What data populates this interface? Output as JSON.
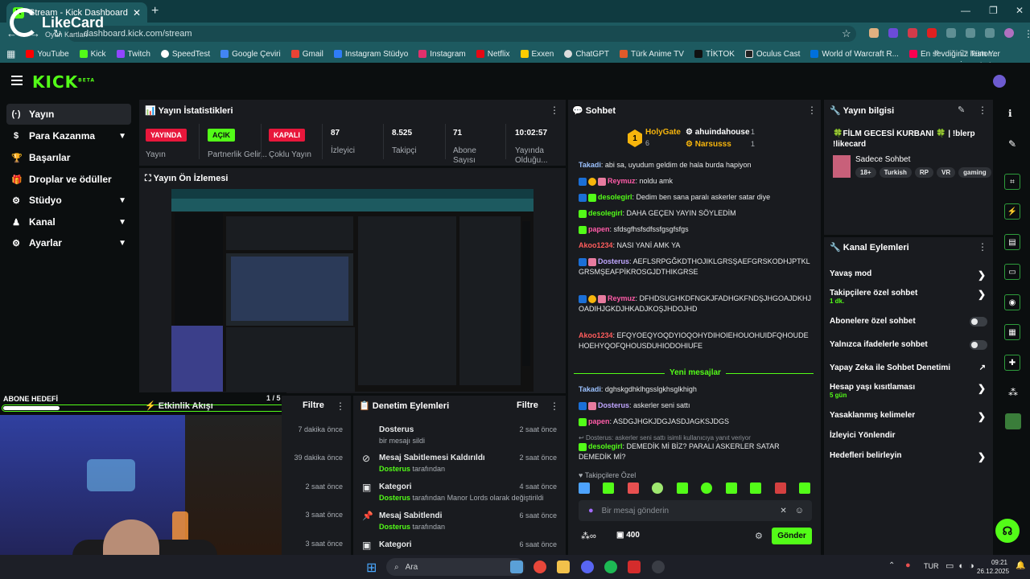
{
  "browser": {
    "tab_title": "Stream - Kick Dashboard",
    "url": "dashboard.kick.com/stream",
    "bookmarks": [
      "YouTube",
      "Kick",
      "Twitch",
      "SpeedTest",
      "Google Çeviri",
      "Gmail",
      "Instagram Stüdyo",
      "Instagram",
      "Netflix",
      "Exxen",
      "ChatGPT",
      "Türk Anime TV",
      "TİKTOK",
      "Oculus Cast",
      "World of Warcraft R...",
      "En sevdiğiniz restor..."
    ],
    "all_bookmarks": "Tüm Yer İşaretleri",
    "watermark_brand": "LikeCard",
    "watermark_sub": "Oyun Kartları"
  },
  "app": {
    "logo": "KICK",
    "logo_sup": "BETA"
  },
  "sidebar": {
    "items": [
      {
        "label": "Yayın",
        "icon": "(·)"
      },
      {
        "label": "Para Kazanma",
        "icon": "$"
      },
      {
        "label": "Başarılar",
        "icon": "🏆"
      },
      {
        "label": "Droplar ve ödüller",
        "icon": "🎁"
      },
      {
        "label": "Stüdyo",
        "icon": "⚙"
      },
      {
        "label": "Kanal",
        "icon": "♟"
      },
      {
        "label": "Ayarlar",
        "icon": "⚙"
      }
    ]
  },
  "stats": {
    "title": "Yayın İstatistikleri",
    "items": [
      {
        "value": "YAYINDA",
        "label": "Yayın"
      },
      {
        "value": "AÇIK",
        "label": "Partnerlik Gelir..."
      },
      {
        "value": "KAPALI",
        "label": "Çoklu Yayın"
      },
      {
        "value": "87",
        "label": "İzleyici"
      },
      {
        "value": "8.525",
        "label": "Takipçi"
      },
      {
        "value": "71",
        "label": "Abone Sayısı"
      },
      {
        "value": "10:02:57",
        "label": "Yayında Olduğu..."
      }
    ]
  },
  "preview": {
    "title": "Yayın Ön İzlemesi"
  },
  "sub_goal": {
    "label": "ABONE HEDEFİ",
    "progress": 0.2
  },
  "activity": {
    "title": "Etkinlik Akışı",
    "page": "1 / 5",
    "filter": "Filtre",
    "times": [
      "7 dakika önce",
      "39 dakika önce",
      "2 saat önce",
      "3 saat önce",
      "3 saat önce"
    ]
  },
  "mod": {
    "title": "Denetim Eylemleri",
    "filter": "Filtre",
    "items": [
      {
        "title": "Dosterus",
        "sub_user": "",
        "sub": "bir mesajı sildi",
        "time": "2 saat önce",
        "icon": ""
      },
      {
        "title": "Mesaj Sabitlemesi Kaldırıldı",
        "sub_user": "Dosterus",
        "sub": "tarafından",
        "time": "2 saat önce",
        "icon": "⊘"
      },
      {
        "title": "Kategori",
        "sub_user": "Dosterus",
        "sub": "tarafından Manor Lords olarak değiştirildi",
        "time": "4 saat önce",
        "icon": "▣"
      },
      {
        "title": "Mesaj Sabitlendi",
        "sub_user": "Dosterus",
        "sub": "tarafından",
        "time": "6 saat önce",
        "icon": "📌"
      },
      {
        "title": "Kategori",
        "sub_user": "",
        "sub": "",
        "time": "6 saat önce",
        "icon": "▣"
      }
    ]
  },
  "chat": {
    "title": "Sohbet",
    "top_gifter": {
      "name": "HolyGate",
      "count": "6",
      "rank": "1"
    },
    "gifter2": {
      "name": "ahuindahouse",
      "count": "1"
    },
    "gifter3": {
      "name": "Narsusss",
      "count": "1"
    },
    "messages": [
      {
        "user": "Takadi",
        "text": "abi sa, uyudum geldim de hala burda hapiyon",
        "color": "#9cc2ff"
      },
      {
        "user": "Reymuz",
        "text": "noldu amk",
        "color": "#ff5ca8"
      },
      {
        "user": "desolegirl",
        "text": "Dedim ben sana paralı askerler satar diye",
        "color": "#53fc18"
      },
      {
        "user": "desolegirl",
        "text": "DAHA GEÇEN YAYIN SÖYLEDİM",
        "color": "#53fc18"
      },
      {
        "user": "papen",
        "text": "sfdsgfhsfsdfssfgsgfsfgs",
        "color": "#ff5ca8"
      },
      {
        "user": "Akoo1234",
        "text": "NASI YANİ AMK YA",
        "color": "#ff5c5c"
      },
      {
        "user": "Dosterus",
        "text": "AEFLSRPGĞKDTHOJIKLGRSŞAEFGRSKODHJPTKLGRSMŞEAFPİKROSGJDTHIKGRSE",
        "color": "#c0a6ff"
      },
      {
        "user": "Reymuz",
        "text": "DFHDSUGHKDFNGKJFADHGKFNDŞJHGOAJDKHJOADIHJGKDJHKADJKOŞJHDOJHD",
        "color": "#ff5ca8"
      },
      {
        "user": "Akoo1234",
        "text": "EFQYOEQYOQDYIOQOHYDIHOIEHOUOHUIDFQHOUDEHOEHYQOFQHOUSDUHIODOHIUFE",
        "color": "#ff5c5c"
      },
      {
        "user": "Takadi",
        "text": "dghskgdhklhgsslgkhsglkhigh",
        "color": "#9cc2ff"
      },
      {
        "user": "Dosterus",
        "text": "askerler seni sattı",
        "color": "#c0a6ff"
      },
      {
        "user": "papen",
        "text": "ASDGJHGKJDGJASDJAGKSJDGS",
        "color": "#ff5ca8"
      },
      {
        "user": "desolegirl",
        "text": "DEMEDİK Mİ BİZ? PARALI ASKERLER SATAR DEMEDİK Mİ?",
        "color": "#53fc18"
      }
    ],
    "reply_note": "Dosterus: askerler seni sattı isimli kullanıcıya yanıt veriyor",
    "new_messages": "Yeni mesajlar",
    "followers_only": "Takipçilere Özel",
    "input_placeholder": "Bir mesaj gönderin",
    "points": "400",
    "send": "Gönder"
  },
  "stream_info": {
    "title": "Yayın bilgisi",
    "stream_title": "🍀FİLM GECESİ KURBANI 🍀 | !blerp !likecard",
    "category": "Sadece Sohbet",
    "tags": [
      "18+",
      "Turkish",
      "RP",
      "VR",
      "gaming"
    ]
  },
  "channel_actions": {
    "title": "Kanal Eylemleri",
    "items": [
      {
        "label": "Yavaş mod",
        "sub": ""
      },
      {
        "label": "Takipçilere özel sohbet",
        "sub": "1 dk."
      },
      {
        "label": "Abonelere özel sohbet",
        "sub": ""
      },
      {
        "label": "Yalnızca ifadelerle sohbet",
        "sub": ""
      },
      {
        "label": "Yapay Zeka ile Sohbet Denetimi",
        "sub": ""
      },
      {
        "label": "Hesap yaşı kısıtlaması",
        "sub": "5 gün"
      },
      {
        "label": "Yasaklanmış kelimeler",
        "sub": ""
      },
      {
        "label": "İzleyici Yönlendir",
        "sub": ""
      },
      {
        "label": "Hedefleri belirleyin",
        "sub": ""
      }
    ]
  },
  "taskbar": {
    "search": "Ara",
    "lang": "TUR",
    "time": "09:21",
    "date": "26.12.2025"
  },
  "colors": {
    "accent": "#53fc18",
    "live": "#e8173b",
    "on": "#53fc18",
    "panel": "#191b1f"
  }
}
